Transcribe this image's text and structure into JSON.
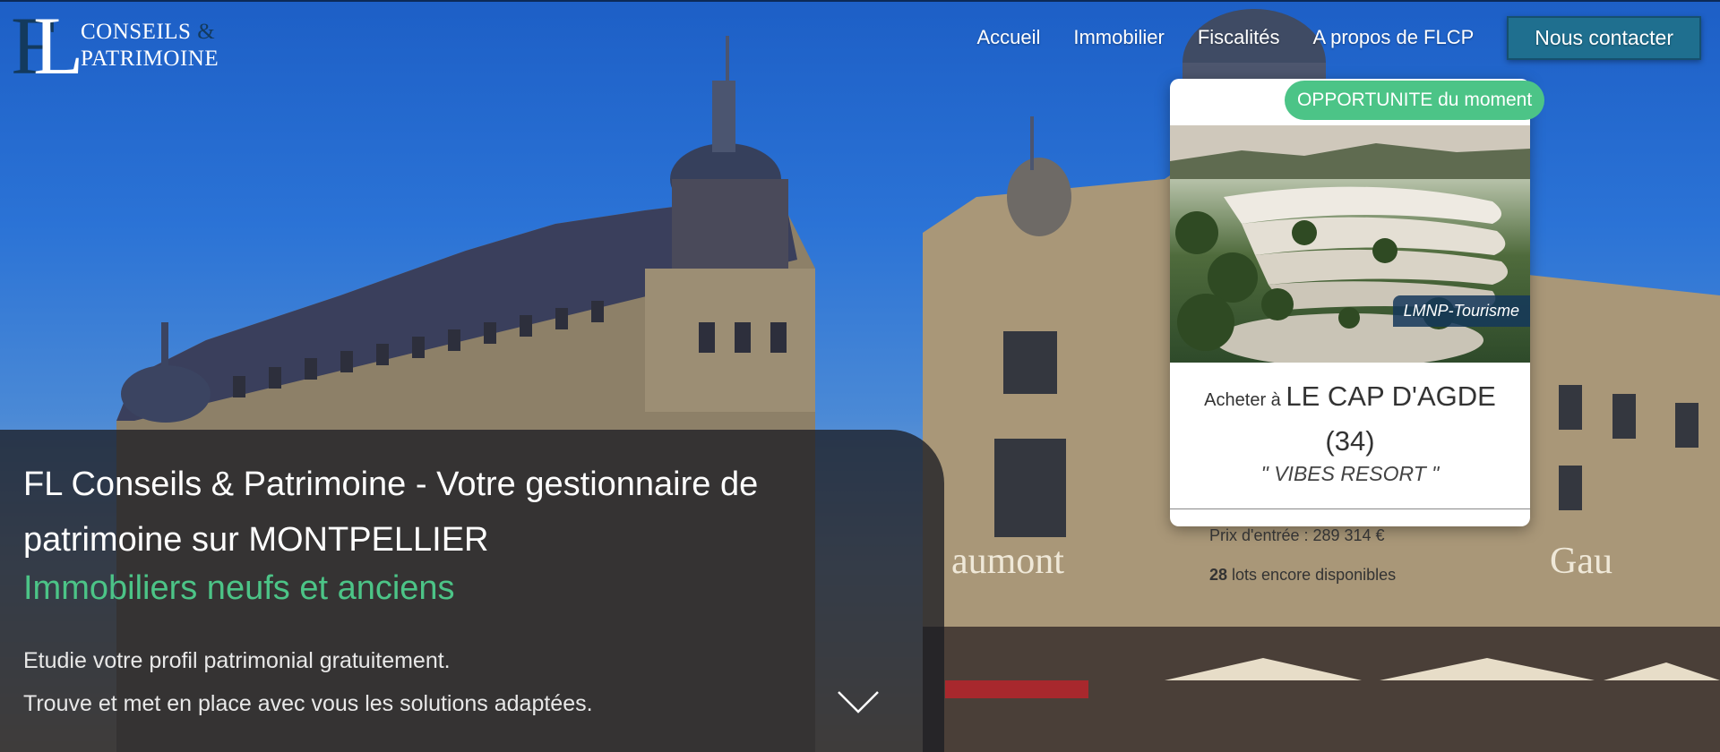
{
  "logo": {
    "word1": "CONSEILS",
    "amp": "&",
    "word2": "PATRIMOINE",
    "mark": "FL"
  },
  "nav": {
    "items": [
      {
        "label": "Accueil"
      },
      {
        "label": "Immobilier"
      },
      {
        "label": "Fiscalités"
      },
      {
        "label": "A propos de FLCP"
      }
    ],
    "contact_label": "Nous contacter"
  },
  "card": {
    "badge": "OPPORTUNITE du moment",
    "tag": "LMNP-Tourisme",
    "title_prefix": "Acheter à",
    "title_city": "LE CAP D'AGDE",
    "title_dept": "(34)",
    "subtitle": "\" VIBES RESORT \"",
    "price": "Prix d'entrée : 289 314 €",
    "lots_count": "28",
    "lots_text": " lots encore disponibles"
  },
  "hero": {
    "title": "FL Conseils & Patrimoine - Votre gestionnaire de patrimoine sur MONTPELLIER",
    "subtitle": "Immobiliers neufs et anciens",
    "line1": "Etudie votre profil patrimonial gratuitement.",
    "line2": "Trouve et met en place avec vous les solutions adaptées.",
    "scroll_icon": "chevron-down-icon"
  },
  "colors": {
    "accent_green": "#4cc487",
    "contact_blue": "#1f6f8f",
    "panel": "#1c1e24"
  }
}
